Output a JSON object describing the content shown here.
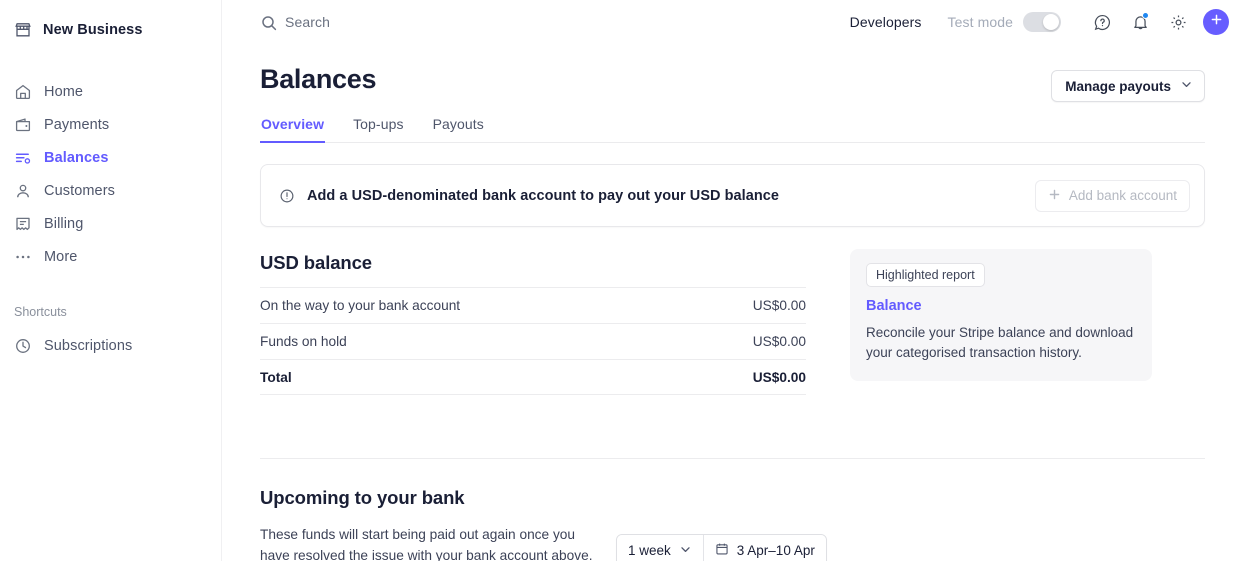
{
  "sidebar": {
    "brand": {
      "name": "New Business",
      "icon": "storefront-icon"
    },
    "items": [
      {
        "label": "Home",
        "icon": "home-icon",
        "active": false
      },
      {
        "label": "Payments",
        "icon": "wallet-icon",
        "active": false
      },
      {
        "label": "Balances",
        "icon": "balances-icon",
        "active": true
      },
      {
        "label": "Customers",
        "icon": "person-icon",
        "active": false
      },
      {
        "label": "Billing",
        "icon": "billing-icon",
        "active": false
      },
      {
        "label": "More",
        "icon": "ellipsis-icon",
        "active": false
      }
    ],
    "shortcuts_label": "Shortcuts",
    "shortcuts": [
      {
        "label": "Subscriptions",
        "icon": "clock-icon"
      }
    ]
  },
  "topbar": {
    "search_placeholder": "Search",
    "search_icon": "search-icon",
    "developers_label": "Developers",
    "test_mode_label": "Test mode",
    "test_mode_on": true,
    "help_icon": "help-circle-icon",
    "notifications_icon": "bell-icon",
    "notifications_has_badge": true,
    "settings_icon": "gear-icon",
    "add_icon": "plus-icon"
  },
  "page": {
    "title": "Balances",
    "manage_payouts_label": "Manage payouts",
    "manage_payouts_icon": "chevron-down-icon",
    "tabs": [
      {
        "label": "Overview",
        "active": true
      },
      {
        "label": "Top-ups",
        "active": false
      },
      {
        "label": "Payouts",
        "active": false
      }
    ]
  },
  "banner": {
    "icon": "alert-circle-icon",
    "message": "Add a USD-denominated bank account to pay out your USD balance",
    "action_label": "Add bank account",
    "action_icon": "plus-icon"
  },
  "balance": {
    "title": "USD balance",
    "rows": [
      {
        "label": "On the way to your bank account",
        "value": "US$0.00"
      },
      {
        "label": "Funds on hold",
        "value": "US$0.00"
      }
    ],
    "total": {
      "label": "Total",
      "value": "US$0.00"
    }
  },
  "report_card": {
    "chip": "Highlighted report",
    "link": "Balance",
    "description": "Reconcile your Stripe balance and download your categorised transaction history."
  },
  "upcoming": {
    "title": "Upcoming to your bank",
    "description": "These funds will start being paid out again once you have resolved the issue with your bank account above.",
    "period_label": "1 week",
    "period_icon": "chevron-down-icon",
    "date_range": "3 Apr–10 Apr",
    "date_icon": "calendar-icon"
  },
  "colors": {
    "accent": "#635bff",
    "plus_button": "#675dff",
    "badge": "#1f87f0",
    "text": "#1a1f36",
    "muted": "#4f566b",
    "card_bg": "#f6f6f8"
  }
}
